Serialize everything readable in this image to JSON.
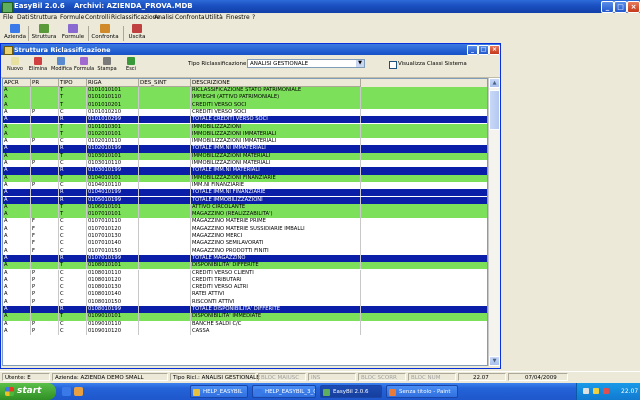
{
  "app": {
    "title": "EasyBil 2.0.6",
    "archive": "Archivi: AZIENDA_PROVA.MDB"
  },
  "menu": [
    "File",
    "Dati",
    "Struttura",
    "Formule",
    "Controlli",
    "Riclassificazione",
    "Analisi",
    "Confronta",
    "Utilità",
    "Finestre",
    "?"
  ],
  "main_toolbar": [
    {
      "label": "Azienda",
      "color": "#3a7ae8"
    },
    {
      "label": "Struttura",
      "color": "#5a9a3a"
    },
    {
      "label": "Formule",
      "color": "#8a6ad0"
    },
    {
      "label": "Confronta",
      "color": "#d08a2a"
    },
    {
      "label": "Uscita",
      "color": "#c04040"
    }
  ],
  "child": {
    "title": "Struttura Riclassificazione",
    "toolbar": [
      {
        "label": "Nuovo",
        "color": "#e8e0a0"
      },
      {
        "label": "Elimina",
        "color": "#d04040"
      },
      {
        "label": "Modifica",
        "color": "#5a8ad0"
      },
      {
        "label": "Formula",
        "color": "#a06ad0"
      },
      {
        "label": "Stampa",
        "color": "#7a7a7a"
      },
      {
        "label": "Esci",
        "color": "#3a9a3a"
      }
    ],
    "tipo_label": "Tipo Riclassificazione",
    "tipo_value": "ANALISI GESTIONALE",
    "checkbox_label": "Visualizza Classi Sistema"
  },
  "grid": {
    "columns": [
      "APCR",
      "PR",
      "TIPO",
      "RIGA",
      "DES_SINT",
      "DESCRIZIONE"
    ],
    "rows": [
      {
        "apcr": "A",
        "pr": "",
        "tipo": "T",
        "riga": "0101010101",
        "des": "",
        "descr": "RICLASSIFICAZIONE STATO PATRIMONIALE"
      },
      {
        "apcr": "A",
        "pr": "",
        "tipo": "T",
        "riga": "0101010110",
        "des": "",
        "descr": "IMPIEGHI (ATTIVO PATRIMONIALE)"
      },
      {
        "apcr": "A",
        "pr": "",
        "tipo": "T",
        "riga": "0101010201",
        "des": "",
        "descr": "CREDITI VERSO SOCI"
      },
      {
        "apcr": "A",
        "pr": "P",
        "tipo": "C",
        "riga": "0101010210",
        "des": "",
        "descr": "CREDITI VERSO SOCI"
      },
      {
        "apcr": "A",
        "pr": "",
        "tipo": "R",
        "riga": "0101010299",
        "des": "",
        "descr": "TOTALE CREDITI VERSO SOCI"
      },
      {
        "apcr": "A",
        "pr": "",
        "tipo": "T",
        "riga": "0101010301",
        "des": "",
        "descr": "IMMOBILIZZAZIONI"
      },
      {
        "apcr": "A",
        "pr": "",
        "tipo": "T",
        "riga": "0102010101",
        "des": "",
        "descr": "IMMOBILIZZAZIONI IMMATERIALI"
      },
      {
        "apcr": "A",
        "pr": "P",
        "tipo": "C",
        "riga": "0102010110",
        "des": "",
        "descr": "IMMOBILIZZAZIONI IMMATERIALI"
      },
      {
        "apcr": "A",
        "pr": "",
        "tipo": "R",
        "riga": "0102010199",
        "des": "",
        "descr": "TOTALE IMM.NI IMMATERIALI"
      },
      {
        "apcr": "A",
        "pr": "",
        "tipo": "T",
        "riga": "0103010101",
        "des": "",
        "descr": "IMMOBILIZZAZIONI MATERIALI"
      },
      {
        "apcr": "A",
        "pr": "P",
        "tipo": "C",
        "riga": "0103010110",
        "des": "",
        "descr": "IMMOBILIZZAZIONI MATERIALI"
      },
      {
        "apcr": "A",
        "pr": "",
        "tipo": "R",
        "riga": "0103010199",
        "des": "",
        "descr": "TOTALE IMM.NI MATERIALI"
      },
      {
        "apcr": "A",
        "pr": "",
        "tipo": "T",
        "riga": "0104010101",
        "des": "",
        "descr": "IMMOBILIZZAZIONI FINANZIARIE"
      },
      {
        "apcr": "A",
        "pr": "P",
        "tipo": "C",
        "riga": "0104010110",
        "des": "",
        "descr": "IMM.NI FINANZIARIE"
      },
      {
        "apcr": "A",
        "pr": "",
        "tipo": "R",
        "riga": "0104010199",
        "des": "",
        "descr": "TOTALE IMM.NI FINANZIARIE"
      },
      {
        "apcr": "A",
        "pr": "",
        "tipo": "R",
        "riga": "0105010199",
        "des": "",
        "descr": "TOTALE IMMOBILIZZAZIONI"
      },
      {
        "apcr": "A",
        "pr": "",
        "tipo": "T",
        "riga": "0106010101",
        "des": "",
        "descr": "ATTIVO CIRCOLANTE"
      },
      {
        "apcr": "A",
        "pr": "",
        "tipo": "T",
        "riga": "0107010101",
        "des": "",
        "descr": "MAGAZZINO (REALIZZABILITA')"
      },
      {
        "apcr": "A",
        "pr": "F",
        "tipo": "C",
        "riga": "0107010110",
        "des": "",
        "descr": "MAGAZZINO MATERIE PRIME"
      },
      {
        "apcr": "A",
        "pr": "F",
        "tipo": "C",
        "riga": "0107010120",
        "des": "",
        "descr": "MAGAZZINO MATERIE SUSSIDIARIE IMBALLI"
      },
      {
        "apcr": "A",
        "pr": "F",
        "tipo": "C",
        "riga": "0107010130",
        "des": "",
        "descr": "MAGAZZINO MERCI"
      },
      {
        "apcr": "A",
        "pr": "F",
        "tipo": "C",
        "riga": "0107010140",
        "des": "",
        "descr": "MAGAZZINO SEMILAVORATI"
      },
      {
        "apcr": "A",
        "pr": "F",
        "tipo": "C",
        "riga": "0107010150",
        "des": "",
        "descr": "MAGAZZINO PRODOTTI FINITI"
      },
      {
        "apcr": "A",
        "pr": "",
        "tipo": "R",
        "riga": "0107010199",
        "des": "",
        "descr": "TOTALE MAGAZZINO"
      },
      {
        "apcr": "A",
        "pr": "",
        "tipo": "T",
        "riga": "0108010101",
        "des": "",
        "descr": "DISPONIBILITA' DIFFERITE"
      },
      {
        "apcr": "A",
        "pr": "P",
        "tipo": "C",
        "riga": "0108010110",
        "des": "",
        "descr": "CREDITI VERSO CLIENTI"
      },
      {
        "apcr": "A",
        "pr": "P",
        "tipo": "C",
        "riga": "0108010120",
        "des": "",
        "descr": "CREDITI TRIBUTARI"
      },
      {
        "apcr": "A",
        "pr": "P",
        "tipo": "C",
        "riga": "0108010130",
        "des": "",
        "descr": "CREDITI VERSO ALTRI"
      },
      {
        "apcr": "A",
        "pr": "P",
        "tipo": "C",
        "riga": "0108010140",
        "des": "",
        "descr": "RATEI ATTIVI"
      },
      {
        "apcr": "A",
        "pr": "P",
        "tipo": "C",
        "riga": "0108010150",
        "des": "",
        "descr": "RISCONTI ATTIVI"
      },
      {
        "apcr": "A",
        "pr": "",
        "tipo": "R",
        "riga": "0108010199",
        "des": "",
        "descr": "TOTALE DISPONIBILITA' DIFFERITE"
      },
      {
        "apcr": "A",
        "pr": "",
        "tipo": "T",
        "riga": "0109010101",
        "des": "",
        "descr": "DISPONIBILITA' IMMEDIATE"
      },
      {
        "apcr": "A",
        "pr": "P",
        "tipo": "C",
        "riga": "0109010110",
        "des": "",
        "descr": "BANCHE SALDI C/C"
      },
      {
        "apcr": "A",
        "pr": "P",
        "tipo": "C",
        "riga": "0109010120",
        "des": "",
        "descr": "CASSA"
      }
    ]
  },
  "status": {
    "utente": "Utente: E",
    "azienda": "Azienda: AZIENDA DEMO SMALL",
    "tipo": "Tipo Ricl.: ANALISI GESTIONALE",
    "maiusc": "BLOC MAIUSC",
    "ins": "INS",
    "scorr": "BLOC SCORR",
    "num": "BLOC NUM",
    "time": "22.07",
    "date": "07/04/2009"
  },
  "taskbar": {
    "start": "start",
    "tasks": [
      {
        "label": "HELP_EASYBIL",
        "color": "#e8c040",
        "active": false
      },
      {
        "label": "HELP_EASYBIL_3_0N...",
        "color": "#3a7ae8",
        "active": false
      },
      {
        "label": "EasyBil 2.0.6",
        "color": "#5fae5f",
        "active": true
      },
      {
        "label": "Senza titolo - Paint",
        "color": "#e87a3a",
        "active": false
      }
    ],
    "clock": "22.07"
  },
  "colors": {
    "title_row": "#7ce05a",
    "total_row": "#0a1ea8",
    "xp_blue": "#245edc"
  }
}
